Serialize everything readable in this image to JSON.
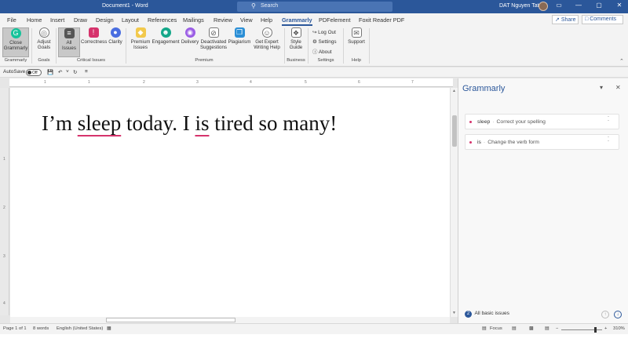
{
  "titlebar": {
    "doc_title": "Document1 - Word",
    "search_placeholder": "Search",
    "user_name": "DAT Nguyen Tat",
    "minimize": "—",
    "restore": "▢",
    "close": "✕",
    "ribbon_toggle": "▭"
  },
  "tabs": [
    "File",
    "Home",
    "Insert",
    "Draw",
    "Design",
    "Layout",
    "References",
    "Mailings",
    "Review",
    "View",
    "Help",
    "Grammarly",
    "PDFelement",
    "Foxit Reader PDF"
  ],
  "active_tab": "Grammarly",
  "share_label": "Share",
  "comments_label": "Comments",
  "ribbon": {
    "close_grammarly": "Close Grammarly",
    "adjust_goals": "Adjust Goals",
    "all_issues": "All Issues",
    "correctness": "Correctness",
    "clarity": "Clarity",
    "premium_issues": "Premium Issues",
    "engagement": "Engagement",
    "delivery": "Delivery",
    "deactivated_suggestions": "Deactivated Suggestions",
    "plagiarism": "Plagiarism",
    "get_expert": "Get Expert Writing Help",
    "style_guide": "Style Guide",
    "log_out": "Log Out",
    "settings": "Settings",
    "about": "About",
    "support": "Support",
    "group_labels": {
      "grammarly": "Grammarly",
      "goals": "Goals",
      "critical": "Critical Issues",
      "premium": "Premium",
      "business": "Business",
      "settings": "Settings",
      "help": "Help"
    }
  },
  "qat": {
    "autosave_label": "AutoSave",
    "autosave_state": "Off"
  },
  "document": {
    "part1": "I’m ",
    "flag1": "sleep",
    "part2": " today. I ",
    "flag2": "is",
    "part3": " tired so many!"
  },
  "grammarly_pane": {
    "title": "Grammarly",
    "suggestions": [
      {
        "word": "sleep",
        "separator": "·",
        "desc": "Correct your spelling"
      },
      {
        "word": "is",
        "separator": "·",
        "desc": "Change the verb form"
      }
    ],
    "footer_count": "2",
    "footer_label": "All basic issues"
  },
  "statusbar": {
    "page": "Page 1 of 1",
    "words": "8 words",
    "language": "English (United States)",
    "focus": "Focus",
    "zoom": "310%"
  },
  "ruler_ticks": [
    "1",
    "1",
    "2",
    "3",
    "4",
    "5",
    "6",
    "7"
  ],
  "vruler_ticks": [
    "1",
    "2",
    "3",
    "4"
  ],
  "colors": {
    "accent": "#2b579a",
    "issue": "#d6336c",
    "grammarly_green": "#15c39a"
  }
}
